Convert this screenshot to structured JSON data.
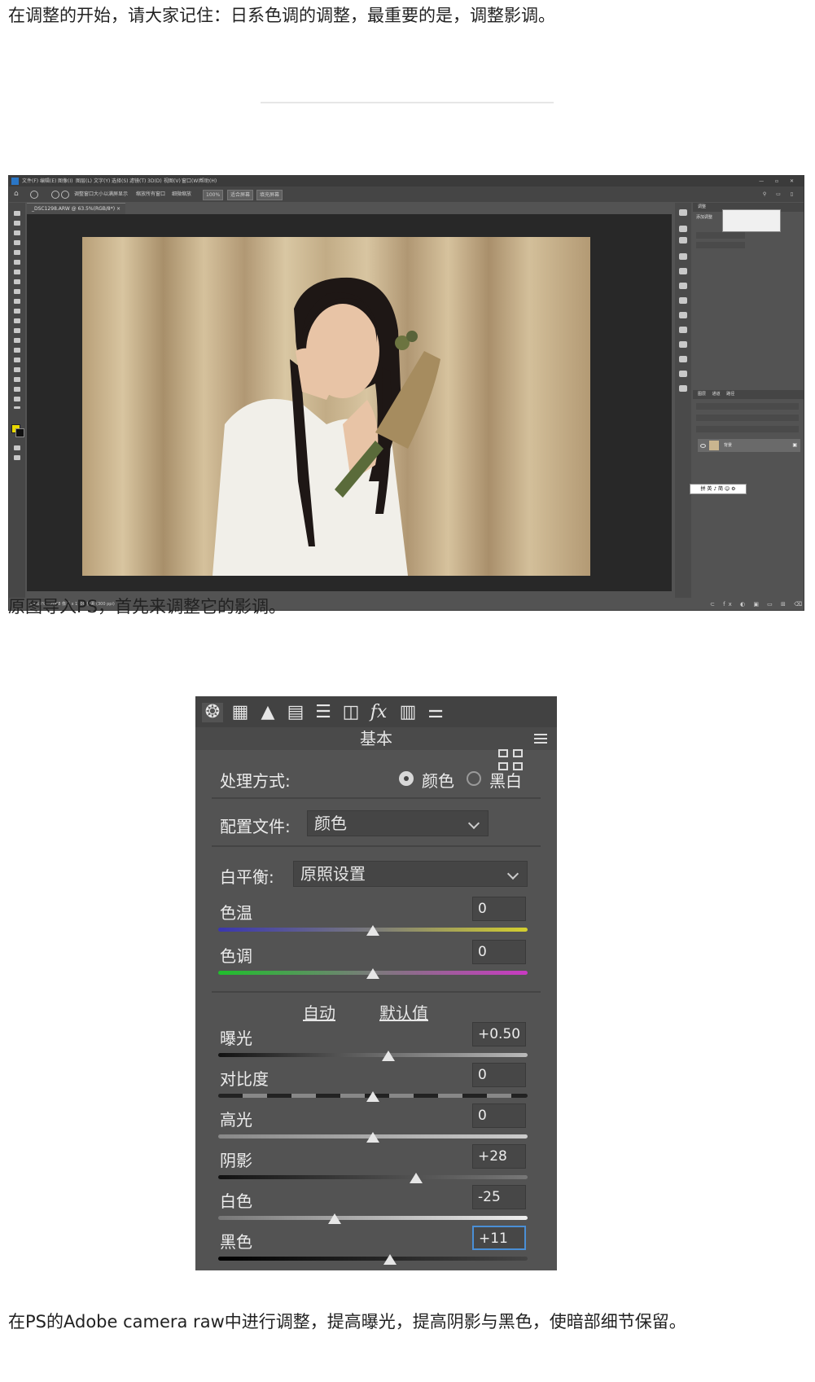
{
  "article": {
    "para1": "在调整的开始，请大家记住：日系色调的调整，最重要的是，调整影调。",
    "para2": "原图导入PS，首先来调整它的影调。",
    "para3": "在PS的Adobe camera raw中进行调整，提高曝光，提高阴影与黑色，使暗部细节保留。"
  },
  "photoshop": {
    "menu": [
      "文件(F)",
      "编辑(E)",
      "图像(I)",
      "图层(L)",
      "文字(Y)",
      "选择(S)",
      "滤镜(T)",
      "3D(D)",
      "视图(V)",
      "窗口(W)",
      "帮助(H)"
    ],
    "options": {
      "resize_windows": "调整窗口大小以满屏显示",
      "zoom_all": "缩放所有窗口",
      "scrubby_zoom": "细微缩放",
      "zoom_value": "100%",
      "fit_screen": "适合屏幕",
      "fill_screen": "填充屏幕"
    },
    "doc_tab": "_DSC1298.ARW @ 63.5%(RGB/8*) ×",
    "status": {
      "zoom": "63.63%",
      "dims": "2048 像素 x 1700 像素 (300 ppi)"
    },
    "panels": {
      "top_tabs": [
        "调整"
      ],
      "add_adjustment": "添加调整",
      "layer_tabs": [
        "图层",
        "通道",
        "路径"
      ],
      "layer_name": "背景"
    },
    "float_toolbar": "拼 英 ♪ 简 ☺ ⚙"
  },
  "acr": {
    "title": "基本",
    "treatment_label": "处理方式:",
    "treatment_options": [
      "颜色",
      "黑白"
    ],
    "treatment_selected": "颜色",
    "profile_label": "配置文件:",
    "profile_value": "颜色",
    "wb_label": "白平衡:",
    "wb_value": "原照设置",
    "auto": "自动",
    "default": "默认值",
    "sliders": [
      {
        "name": "色温",
        "value": "0",
        "level": 0.5
      },
      {
        "name": "色调",
        "value": "0",
        "level": 0.5
      },
      {
        "name": "曝光",
        "value": "+0.50",
        "level": 0.55
      },
      {
        "name": "对比度",
        "value": "0",
        "level": 0.5
      },
      {
        "name": "高光",
        "value": "0",
        "level": 0.5
      },
      {
        "name": "阴影",
        "value": "+28",
        "level": 0.64
      },
      {
        "name": "白色",
        "value": "-25",
        "level": 0.375
      },
      {
        "name": "黑色",
        "value": "+11",
        "level": 0.555
      }
    ]
  }
}
